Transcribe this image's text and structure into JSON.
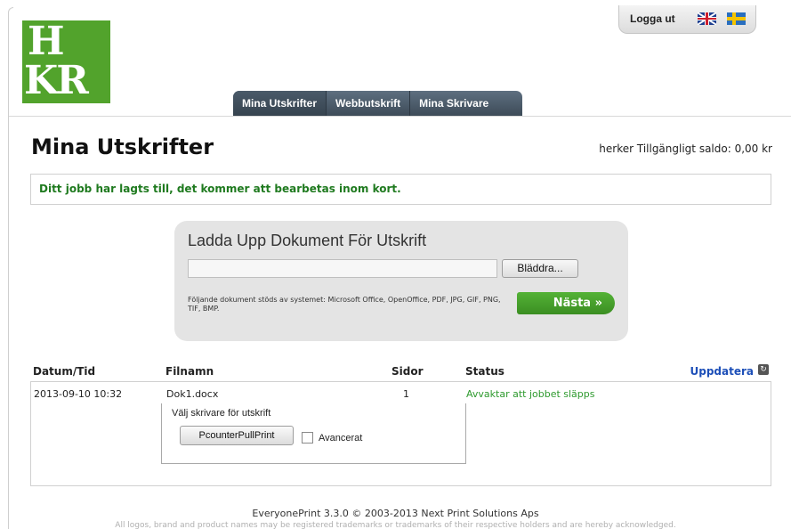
{
  "logo": {
    "line1": "H",
    "line2": "KR"
  },
  "topbar": {
    "logout_label": "Logga ut",
    "flags": [
      "uk-flag-icon",
      "sweden-flag-icon"
    ]
  },
  "tabs": [
    {
      "label": "Mina Utskrifter",
      "active": true
    },
    {
      "label": "Webbutskrift",
      "active": false
    },
    {
      "label": "Mina Skrivare",
      "active": false
    }
  ],
  "page": {
    "title": "Mina Utskrifter",
    "balance": "herker Tillgängligt saldo: 0,00 kr",
    "notice": "Ditt jobb har lagts till, det kommer att bearbetas inom kort."
  },
  "upload": {
    "title": "Ladda Upp Dokument För Utskrift",
    "file_value": "",
    "browse_label": "Bläddra...",
    "supported_text": "Följande dokument stöds av systemet: Microsoft Office, OpenOffice, PDF, JPG, GIF, PNG, TIF, BMP.",
    "next_label": "Nästa »"
  },
  "jobs": {
    "columns": {
      "date": "Datum/Tid",
      "filename": "Filnamn",
      "pages": "Sidor",
      "status": "Status"
    },
    "refresh_label": "Uppdatera",
    "rows": [
      {
        "date": "2013-09-10 10:32",
        "filename": "Dok1.docx",
        "pages": "1",
        "status": "Avvaktar att jobbet släpps",
        "printer_label": "Välj skrivare för utskrift",
        "printer_button": "PcounterPullPrint",
        "advanced_label": "Avancerat",
        "advanced_checked": false
      }
    ]
  },
  "footer": {
    "main": "EveryonePrint 3.3.0 © 2003-2013 Next Print Solutions Aps",
    "small": "All logos, brand and product names may be registered trademarks or trademarks of their respective holders and are hereby acknowledged."
  },
  "colors": {
    "brand_green": "#52a32c",
    "tab_dark": "#3d4b58",
    "link_blue": "#1d4fb8",
    "status_green": "#2e9a2e"
  }
}
